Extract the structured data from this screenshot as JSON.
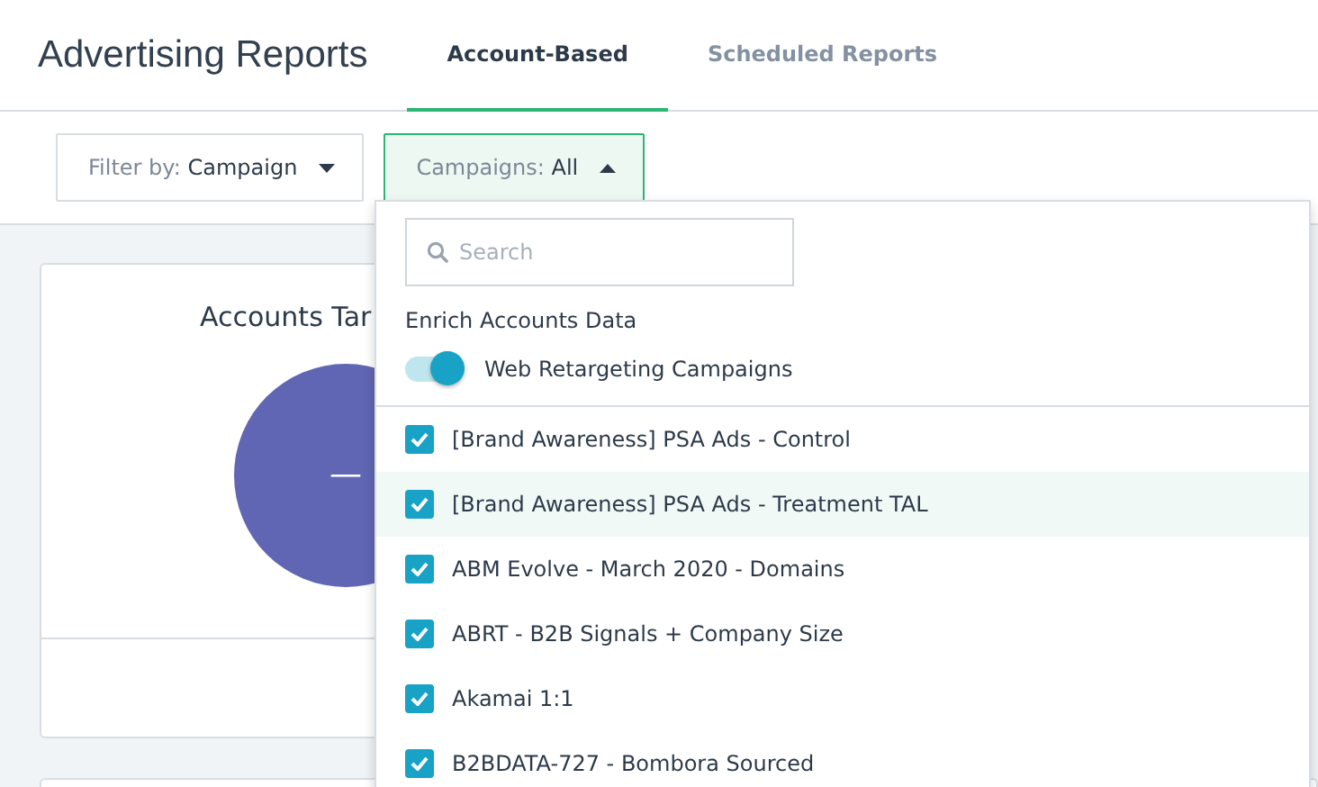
{
  "header": {
    "title": "Advertising Reports",
    "tabs": [
      {
        "label": "Account-Based",
        "selected": true
      },
      {
        "label": "Scheduled Reports",
        "selected": false
      }
    ]
  },
  "filters": [
    {
      "prefix": "Filter by:",
      "value": "Campaign",
      "open": false
    },
    {
      "prefix": "Campaigns:",
      "value": "All",
      "open": true
    }
  ],
  "card": {
    "title": "Accounts Tar",
    "center_label": "—"
  },
  "dropdown": {
    "search": {
      "placeholder": "Search"
    },
    "section_label": "Enrich Accounts Data",
    "toggle": {
      "label": "Web Retargeting Campaigns",
      "on": true
    },
    "items": [
      {
        "label": "[Brand Awareness] PSA Ads - Control",
        "checked": true,
        "selected": false
      },
      {
        "label": "[Brand Awareness] PSA Ads - Treatment TAL",
        "checked": true,
        "selected": true
      },
      {
        "label": "ABM Evolve - March 2020 - Domains",
        "checked": true,
        "selected": false
      },
      {
        "label": "ABRT - B2B Signals + Company Size",
        "checked": true,
        "selected": false
      },
      {
        "label": "Akamai 1:1",
        "checked": true,
        "selected": false
      },
      {
        "label": "B2BDATA-727 - Bombora Sourced",
        "checked": true,
        "selected": false
      }
    ]
  }
}
